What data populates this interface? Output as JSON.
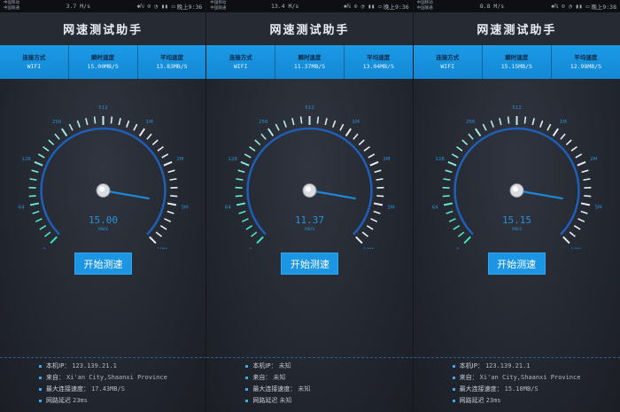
{
  "colors": {
    "accent": "#1b9ae6",
    "gauge_arc": "#1f5fb8",
    "tick_low": "#3ee6c8",
    "tick_high": "#e8eef4",
    "needle": "#1e88d8"
  },
  "screens": [
    {
      "status": {
        "carrier1": "中国移动",
        "carrier2": "中国联通",
        "speed": "3.7 M/s",
        "icons": "✱ℕ ⊙ ◔ ▮▮ ▭",
        "time": "晚上9:36"
      },
      "title": "网速测试助手",
      "info": [
        {
          "label": "连接方式",
          "value": "WIFI"
        },
        {
          "label": "瞬时速度",
          "value": "15.00MB/S"
        },
        {
          "label": "平均速度",
          "value": "13.83MB/S"
        }
      ],
      "gauge": {
        "reading": "15.00",
        "unit": "MB/S",
        "needle_fraction": 0.87,
        "tick_labels": [
          "0",
          "64",
          "128",
          "256",
          "512",
          "1M",
          "2M",
          "5M",
          "10M"
        ]
      },
      "button": "开始测速",
      "details": [
        {
          "label": "本机IP：",
          "value": "123.139.21.1"
        },
        {
          "label": "来自：",
          "value": "Xi'an City,Shaanxi Province"
        },
        {
          "label": "最大连接速度：",
          "value": "17.43MB/S"
        },
        {
          "label": "网路延迟",
          "value": "23ms"
        }
      ]
    },
    {
      "status": {
        "carrier1": "中国移动",
        "carrier2": "中国联通",
        "speed": "13.4 M/s",
        "icons": "✱ℕ ⊙ ◔ ▮▮ ▭",
        "time": "晚上9:36"
      },
      "title": "网速测试助手",
      "info": [
        {
          "label": "连接方式",
          "value": "WIFI"
        },
        {
          "label": "瞬时速度",
          "value": "11.37MB/S"
        },
        {
          "label": "平均速度",
          "value": "13.04MB/S"
        }
      ],
      "gauge": {
        "reading": "11.37",
        "unit": "MB/S",
        "needle_fraction": 0.87,
        "tick_labels": [
          "0",
          "64",
          "128",
          "256",
          "512",
          "1M",
          "2M",
          "5M",
          "10M"
        ]
      },
      "button": "开始测速",
      "details": [
        {
          "label": "本机IP：",
          "value": "未知"
        },
        {
          "label": "来自：",
          "value": "未知"
        },
        {
          "label": "最大连接速度：",
          "value": "未知"
        },
        {
          "label": "网路延迟",
          "value": "未知"
        }
      ]
    },
    {
      "status": {
        "carrier1": "中国移动",
        "carrier2": "中国联通",
        "speed": "8.8 M/s",
        "icons": "✱ℕ ⊙ ◔ ▮▮ ▭",
        "time": "晚上9:38"
      },
      "title": "网速测试助手",
      "info": [
        {
          "label": "连接方式",
          "value": "WIFI"
        },
        {
          "label": "瞬时速度",
          "value": "15.15MB/S"
        },
        {
          "label": "平均速度",
          "value": "12.98MB/S"
        }
      ],
      "gauge": {
        "reading": "15.15",
        "unit": "MB/S",
        "needle_fraction": 0.87,
        "tick_labels": [
          "0",
          "64",
          "128",
          "256",
          "512",
          "1M",
          "2M",
          "5M",
          "10M"
        ]
      },
      "button": "开始测速",
      "details": [
        {
          "label": "本机IP：",
          "value": "123.139.21.1"
        },
        {
          "label": "来自：",
          "value": "Xi'an City,Shaanxi Province"
        },
        {
          "label": "最大连接速度：",
          "value": "15.18MB/S"
        },
        {
          "label": "网路延迟",
          "value": "23ms"
        }
      ]
    }
  ]
}
